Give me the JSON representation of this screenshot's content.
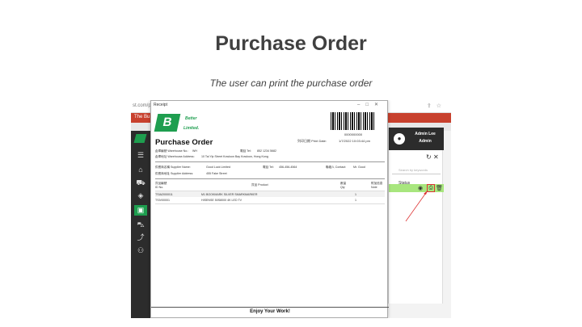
{
  "slide": {
    "title": "Purchase Order",
    "subtitle": "The user can print the purchase order"
  },
  "browser": {
    "url": "st.com/pu",
    "tab_label": "The Bu"
  },
  "right_panel": {
    "user_name": "Admin Lee",
    "user_role": "Admin",
    "search_placeholder": "Search by keywords",
    "status_header": "Status"
  },
  "dialog": {
    "title": "Receipt",
    "logo_line1": "Better",
    "logo_line2": "Limited.",
    "barcode_number": "0000000000",
    "po_title": "Purchase Order",
    "print_date_label": "列印日期 Print Date:",
    "print_date_value": "1/7/2022 10:03:44 pm",
    "warehouse_no_label": "倉庫編號 Warehouse No.:",
    "warehouse_no_value": "WH",
    "phone_label": "電話 Tel:",
    "phone_value": "852 1234 5682",
    "warehouse_addr_label": "倉庫地址 Warehouse Address:",
    "warehouse_addr_value": "10 Tai Yip Street Kowloon Bay Kowloon, Hong Kong",
    "supplier_name_label": "供應商名稱 Supplier Name:",
    "supplier_name_value": "Good Luck Limited",
    "supplier_tel_label": "電話 Tel:",
    "supplier_tel_value": "456-456-4564",
    "contact_label": "聯絡人 Contact:",
    "contact_value": "Mr. Good",
    "supplier_addr_label": "供應商地址 Supplier Address:",
    "supplier_addr_value": "455 Fake Street",
    "table_headers": {
      "sku_zh": "貨品編號",
      "sku_en": "ID No.",
      "product": "貨品 Product",
      "qty_zh": "數量",
      "qty_en": "Qty",
      "note_zh": "附加信息",
      "note_en": "Note"
    },
    "rows": [
      {
        "sku": "TSIA2000011",
        "product": "M1 BOOKMARK SILVER SMARKMARKER",
        "qty": "1"
      },
      {
        "sku": "TSIV00001",
        "product": "HISENSE 50S8000 4K LED TV",
        "qty": "1"
      }
    ],
    "footer": "Enjoy Your Work!"
  }
}
